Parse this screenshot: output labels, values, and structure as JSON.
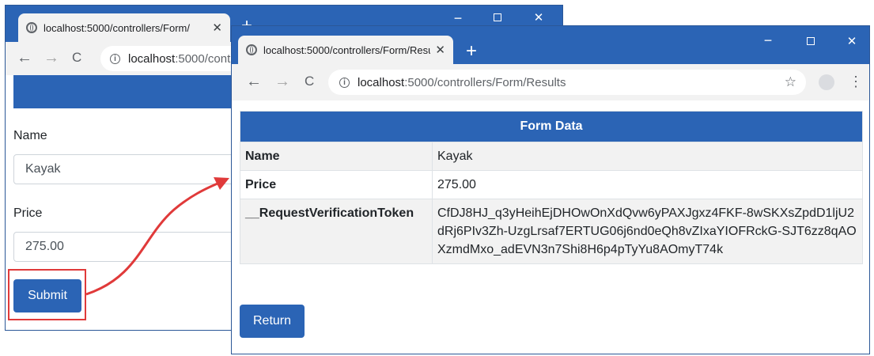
{
  "colors": {
    "accent": "#2b64b5",
    "highlight": "#e03a3a",
    "stripe": "#f2f2f2"
  },
  "back_window": {
    "tab_title": "localhost:5000/controllers/Form/",
    "tab_close": "✕",
    "new_tab": "+",
    "controls": {
      "minimize": "−",
      "close": "✕"
    },
    "nav": {
      "back": "←",
      "forward": "→",
      "reload": "C"
    },
    "address": {
      "host": "localhost",
      "path": ":5000/controllers/Form/"
    },
    "form": {
      "name_label": "Name",
      "name_value": "Kayak",
      "price_label": "Price",
      "price_value": "275.00",
      "submit_label": "Submit"
    }
  },
  "front_window": {
    "tab_title": "localhost:5000/controllers/Form/Results",
    "tab_close": "✕",
    "new_tab": "+",
    "controls": {
      "minimize": "−",
      "close": "✕"
    },
    "nav": {
      "back": "←",
      "forward": "→",
      "reload": "C"
    },
    "address": {
      "host": "localhost",
      "path": ":5000/controllers/Form/Results"
    },
    "toolbar_icons": {
      "star": "☆",
      "menu": "⋮"
    },
    "table": {
      "header": "Form Data",
      "rows": [
        {
          "key": "Name",
          "value": "Kayak"
        },
        {
          "key": "Price",
          "value": "275.00"
        },
        {
          "key": "__RequestVerificationToken",
          "value": "CfDJ8HJ_q3yHeihEjDHOwOnXdQvw6yPAXJgxz4FKF-8wSKXsZpdD1ljU2dRj6PIv3Zh-UzgLrsaf7ERTUG06j6nd0eQh8vZIxaYIOFRckG-SJT6zz8qAOXzmdMxo_adEVN3n7Shi8H6p4pTyYu8AOmyT74k"
        }
      ]
    },
    "return_label": "Return"
  }
}
